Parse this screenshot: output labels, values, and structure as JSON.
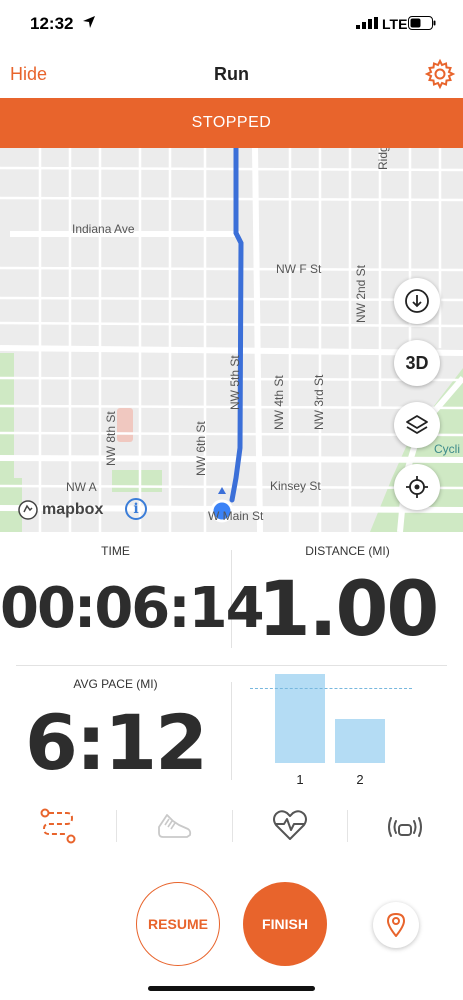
{
  "status_bar": {
    "time": "12:32",
    "carrier": "LTE",
    "icons": [
      "location-arrow-icon",
      "signal-bars-icon",
      "battery-icon"
    ]
  },
  "nav": {
    "left_label": "Hide",
    "title": "Run",
    "right_icon": "gear-icon"
  },
  "banner": {
    "text": "STOPPED"
  },
  "map": {
    "streets": [
      "Indiana Ave",
      "NW F St",
      "NW 2nd St",
      "Ridge St",
      "NW 5th St",
      "NW 4th St",
      "NW 3rd St",
      "NW 8th St",
      "NW 6th St",
      "NW A",
      "Kinsey St",
      "W Main St",
      "Cycli"
    ],
    "buttons": [
      "download-icon",
      "3D",
      "layers-icon",
      "locate-icon"
    ],
    "attribution": "mapbox",
    "route_color": "#3b6fd8",
    "park_color": "#cfe9c4"
  },
  "stats": {
    "time": {
      "label": "TIME",
      "value": "00:06:14"
    },
    "distance": {
      "label": "DISTANCE (MI)",
      "value": "1.00"
    },
    "avg_pace": {
      "label": "AVG PACE (MI)",
      "value": "6:12"
    },
    "splits": {
      "categories": [
        "1",
        "2"
      ],
      "values": [
        1.0,
        0.49
      ],
      "average_line": 0.84,
      "bar_color": "#b4dcf4"
    }
  },
  "tabs": [
    {
      "icon": "route-icon",
      "active": true
    },
    {
      "icon": "shoe-icon",
      "active": false
    },
    {
      "icon": "heart-rate-icon",
      "active": false
    },
    {
      "icon": "sensor-icon",
      "active": false
    }
  ],
  "actions": {
    "resume_label": "RESUME",
    "finish_label": "FINISH",
    "pin_icon": "map-pin-icon"
  },
  "colors": {
    "accent": "#e8642c",
    "route": "#3b6fd8"
  }
}
